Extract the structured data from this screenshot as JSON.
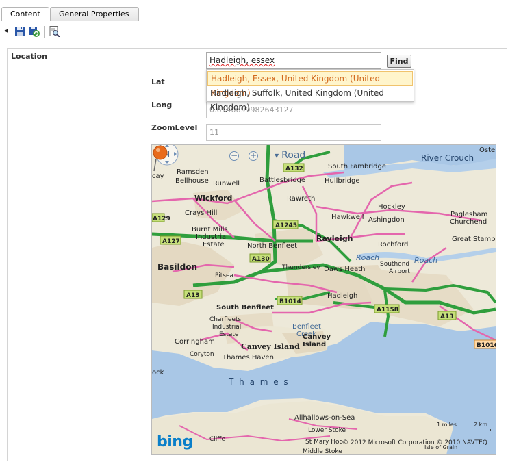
{
  "tabs": [
    {
      "label": "Content",
      "active": true
    },
    {
      "label": "General Properties",
      "active": false
    }
  ],
  "toolbar": {
    "icons": [
      "collapse-arrow-icon",
      "save-icon",
      "save-refresh-icon",
      "preview-icon"
    ]
  },
  "form": {
    "location_label": "Location",
    "search_value": "Hadleigh, essex",
    "find_label": "Find",
    "suggestions": [
      "Hadleigh, Essex, United Kingdom (United Kingdom)",
      "Hadleigh, Suffolk, United Kingdom (United Kingdom)"
    ],
    "lat_label": "Lat",
    "long_label": "Long",
    "long_value": "0.6140699982643127",
    "zoom_label": "ZoomLevel",
    "zoom_value": "11"
  },
  "map": {
    "compass_label": "N",
    "view_label": "Road",
    "brand": "bing",
    "copyright": "© 2012 Microsoft Corporation  © 2010 NAVTEQ",
    "scale_miles": "1 miles",
    "scale_km": "2 km",
    "places": {
      "ostend": "Oste",
      "river_crouch": "River Crouch",
      "south_fambridge": "South Fambridge",
      "ramsden_bellhouse_1": "Ramsden",
      "ramsden_bellhouse_2": "Bellhouse",
      "battlesbridge": "Battlesbridge",
      "hullbridge": "Hullbridge",
      "runwell": "Runwell",
      "cay": "cay",
      "wickford": "Wickford",
      "rawreth": "Rawreth",
      "hockley": "Hockley",
      "crays_hill": "Crays Hill",
      "hawkwell": "Hawkwell",
      "ashingdon": "Ashingdon",
      "paglesham_1": "Paglesham",
      "paglesham_2": "Churchend",
      "burnt_mills_1": "Burnt Mills",
      "burnt_mills_2": "Industrial",
      "burnt_mills_3": "Estate",
      "rayleigh": "Rayleigh",
      "great_stambridge": "Great Stambi",
      "north_benfleet": "North Benfleet",
      "rochford": "Rochford",
      "basildon": "Basildon",
      "thundersley": "Thundersley",
      "daws_heath": "Daws Heath",
      "southend_airport_1": "Southend",
      "southend_airport_2": "Airport",
      "roach_1": "Roach",
      "roach_2": "Roach",
      "pitsea": "Pitsea",
      "hadleigh": "Hadleigh",
      "south_benfleet": "South Benfleet",
      "charfleets_1": "Charfleets",
      "charfleets_2": "Industrial",
      "charfleets_3": "Estate",
      "benfleet": "Benfleet",
      "creek": "Creek",
      "corringham": "Corringham",
      "canvey_island_1": "Canvey Island",
      "canvey_island_2": "Canvey",
      "canvey_island_3": "Island",
      "coryton": "Coryton",
      "thames_haven": "Thames Haven",
      "ock": "ock",
      "thames": "T h a m e s",
      "allhallows": "Allhallows-on-Sea",
      "lower_stoke": "Lower Stoke",
      "st_mary_hoo": "St Mary Hoo",
      "cliffe": "Cliffe",
      "middle_stoke": "Middle Stoke",
      "isle_of_grain": "Isle of Grain"
    },
    "roads": [
      "A132",
      "A1245",
      "A129",
      "A127",
      "A130",
      "A13",
      "B1014",
      "A1158",
      "A13",
      "B1016"
    ]
  }
}
